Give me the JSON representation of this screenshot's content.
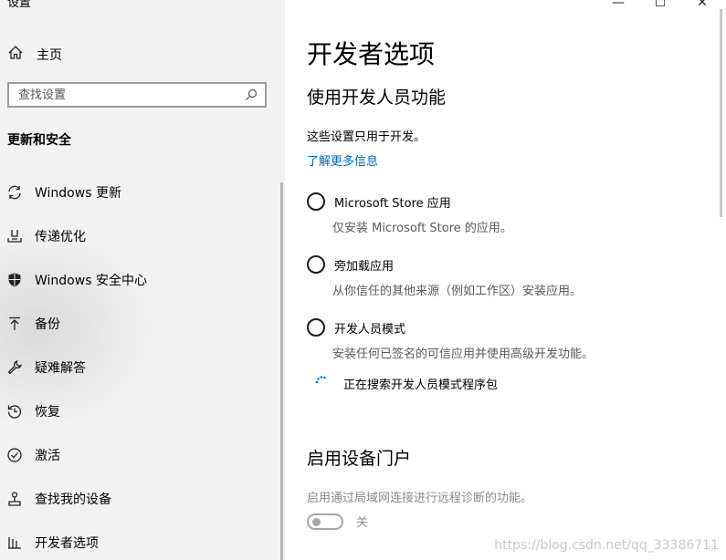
{
  "app": {
    "title": "设置"
  },
  "window": {
    "minimize": "—",
    "maximize": "☐",
    "close": "✕"
  },
  "sidebar": {
    "home_label": "主页",
    "search_placeholder": "查找设置",
    "section_title": "更新和安全",
    "items": [
      {
        "label": "Windows 更新",
        "icon": "sync-icon"
      },
      {
        "label": "传递优化",
        "icon": "delivery-optimization-icon"
      },
      {
        "label": "Windows 安全中心",
        "icon": "shield-icon"
      },
      {
        "label": "备份",
        "icon": "backup-arrow-icon"
      },
      {
        "label": "疑难解答",
        "icon": "wrench-icon"
      },
      {
        "label": "恢复",
        "icon": "recovery-icon"
      },
      {
        "label": "激活",
        "icon": "check-circle-icon"
      },
      {
        "label": "查找我的设备",
        "icon": "find-device-icon"
      },
      {
        "label": "开发者选项",
        "icon": "developer-icon"
      }
    ]
  },
  "main": {
    "page_title": "开发者选项",
    "section_title": "使用开发人员功能",
    "description": "这些设置只用于开发。",
    "learn_more": "了解更多信息",
    "options": [
      {
        "label": "Microsoft Store 应用",
        "description": "仅安装 Microsoft Store 的应用。"
      },
      {
        "label": "旁加载应用",
        "description": "从你信任的其他来源（例如工作区）安装应用。"
      },
      {
        "label": "开发人员模式",
        "description": "安装任何已签名的可信应用并使用高级开发功能。"
      }
    ],
    "status_text": "正在搜索开发人员模式程序包",
    "portal": {
      "title": "启用设备门户",
      "description": "启用通过局域网连接进行远程诊断的功能。",
      "toggle_state": "关"
    }
  },
  "watermark": "https://blog.csdn.net/qq_33386711"
}
